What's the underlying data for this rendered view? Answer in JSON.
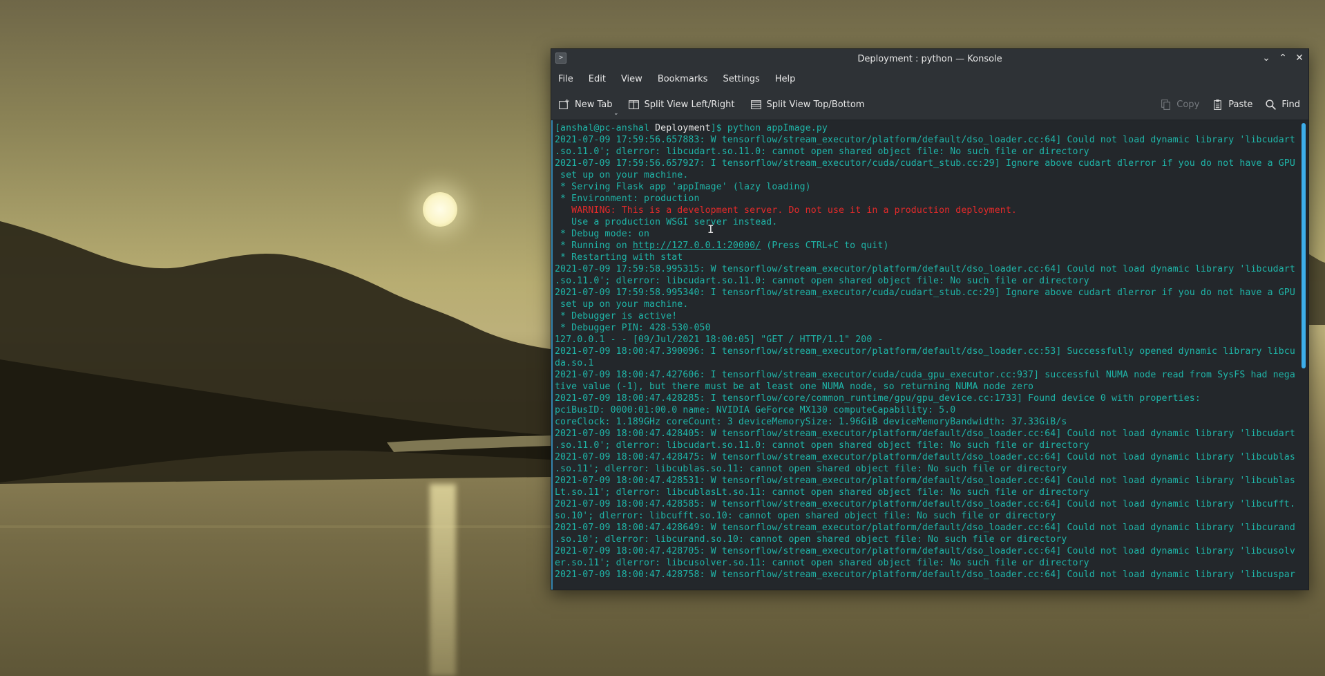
{
  "window": {
    "title": "Deployment : python — Konsole",
    "app_icon_glyph": ">",
    "controls": {
      "minimize": "⌄",
      "maximize": "⌃",
      "close": "✕"
    }
  },
  "menubar": {
    "items": [
      "File",
      "Edit",
      "View",
      "Bookmarks",
      "Settings",
      "Help"
    ]
  },
  "toolbar": {
    "new_tab": "New Tab",
    "split_lr": "Split View Left/Right",
    "split_tb": "Split View Top/Bottom",
    "copy": "Copy",
    "paste": "Paste",
    "find": "Find"
  },
  "terminal": {
    "prompt": {
      "user_host": "[anshal@pc-anshal ",
      "dir": "Deployment",
      "end": "]$ ",
      "command": "python appImage.py"
    },
    "lines": [
      "2021-07-09 17:59:56.657883: W tensorflow/stream_executor/platform/default/dso_loader.cc:64] Could not load dynamic library 'libcudart",
      ".so.11.0'; dlerror: libcudart.so.11.0: cannot open shared object file: No such file or directory",
      "2021-07-09 17:59:56.657927: I tensorflow/stream_executor/cuda/cudart_stub.cc:29] Ignore above cudart dlerror if you do not have a GPU",
      " set up on your machine.",
      " * Serving Flask app 'appImage' (lazy loading)",
      " * Environment: production",
      "   WARNING: This is a development server. Do not use it in a production deployment.",
      "   Use a production WSGI server instead.",
      " * Debug mode: on",
      " * Running on ",
      " * Restarting with stat",
      "2021-07-09 17:59:58.995315: W tensorflow/stream_executor/platform/default/dso_loader.cc:64] Could not load dynamic library 'libcudart",
      ".so.11.0'; dlerror: libcudart.so.11.0: cannot open shared object file: No such file or directory",
      "2021-07-09 17:59:58.995340: I tensorflow/stream_executor/cuda/cudart_stub.cc:29] Ignore above cudart dlerror if you do not have a GPU",
      " set up on your machine.",
      " * Debugger is active!",
      " * Debugger PIN: 428-530-050",
      "127.0.0.1 - - [09/Jul/2021 18:00:05] \"GET / HTTP/1.1\" 200 -",
      "2021-07-09 18:00:47.390096: I tensorflow/stream_executor/platform/default/dso_loader.cc:53] Successfully opened dynamic library libcu",
      "da.so.1",
      "2021-07-09 18:00:47.427606: I tensorflow/stream_executor/cuda/cuda_gpu_executor.cc:937] successful NUMA node read from SysFS had nega",
      "tive value (-1), but there must be at least one NUMA node, so returning NUMA node zero",
      "2021-07-09 18:00:47.428285: I tensorflow/core/common_runtime/gpu/gpu_device.cc:1733] Found device 0 with properties:",
      "pciBusID: 0000:01:00.0 name: NVIDIA GeForce MX130 computeCapability: 5.0",
      "coreClock: 1.189GHz coreCount: 3 deviceMemorySize: 1.96GiB deviceMemoryBandwidth: 37.33GiB/s",
      "2021-07-09 18:00:47.428405: W tensorflow/stream_executor/platform/default/dso_loader.cc:64] Could not load dynamic library 'libcudart",
      ".so.11.0'; dlerror: libcudart.so.11.0: cannot open shared object file: No such file or directory",
      "2021-07-09 18:00:47.428475: W tensorflow/stream_executor/platform/default/dso_loader.cc:64] Could not load dynamic library 'libcublas",
      ".so.11'; dlerror: libcublas.so.11: cannot open shared object file: No such file or directory",
      "2021-07-09 18:00:47.428531: W tensorflow/stream_executor/platform/default/dso_loader.cc:64] Could not load dynamic library 'libcublas",
      "Lt.so.11'; dlerror: libcublasLt.so.11: cannot open shared object file: No such file or directory",
      "2021-07-09 18:00:47.428585: W tensorflow/stream_executor/platform/default/dso_loader.cc:64] Could not load dynamic library 'libcufft.",
      "so.10'; dlerror: libcufft.so.10: cannot open shared object file: No such file or directory",
      "2021-07-09 18:00:47.428649: W tensorflow/stream_executor/platform/default/dso_loader.cc:64] Could not load dynamic library 'libcurand",
      ".so.10'; dlerror: libcurand.so.10: cannot open shared object file: No such file or directory",
      "2021-07-09 18:00:47.428705: W tensorflow/stream_executor/platform/default/dso_loader.cc:64] Could not load dynamic library 'libcusolv",
      "er.so.11'; dlerror: libcusolver.so.11: cannot open shared object file: No such file or directory",
      "2021-07-09 18:00:47.428758: W tensorflow/stream_executor/platform/default/dso_loader.cc:64] Could not load dynamic library 'libcuspar"
    ],
    "running_url": "http://127.0.0.1:20000/",
    "running_suffix": " (Press CTRL+C to quit)",
    "warning_line_index": 6,
    "running_line_index": 9
  },
  "colors": {
    "terminal_text": "#1fb5a8",
    "warning_text": "#e32a2a",
    "accent": "#3daee9",
    "window_bg": "#2e3236",
    "terminal_bg": "#23272b"
  }
}
